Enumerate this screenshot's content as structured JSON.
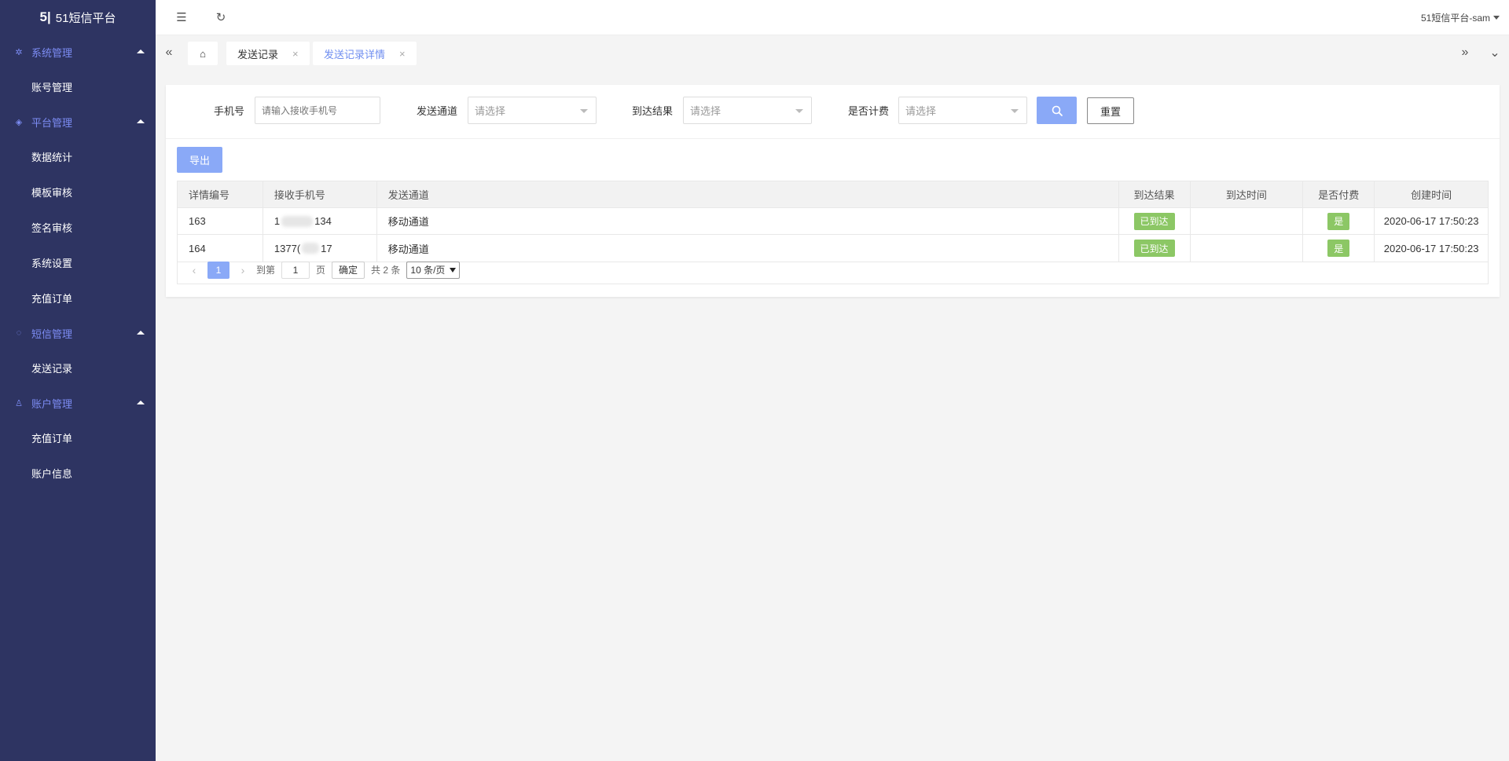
{
  "app": {
    "logo_mark": "5|",
    "title": "51短信平台"
  },
  "sidebar": {
    "groups": [
      {
        "label": "系统管理",
        "icon": "gear-icon",
        "items": [
          {
            "label": "账号管理"
          }
        ]
      },
      {
        "label": "平台管理",
        "icon": "layers-icon",
        "items": [
          {
            "label": "数据统计"
          },
          {
            "label": "模板审核"
          },
          {
            "label": "签名审核"
          },
          {
            "label": "系统设置"
          },
          {
            "label": "充值订单"
          }
        ]
      },
      {
        "label": "短信管理",
        "icon": "message-icon",
        "items": [
          {
            "label": "发送记录"
          }
        ]
      },
      {
        "label": "账户管理",
        "icon": "user-icon",
        "items": [
          {
            "label": "充值订单"
          },
          {
            "label": "账户信息"
          }
        ]
      }
    ]
  },
  "topbar": {
    "user": "51短信平台-sam"
  },
  "tabs": [
    {
      "label": "发送记录",
      "active": false
    },
    {
      "label": "发送记录详情",
      "active": true
    }
  ],
  "filters": {
    "phone": {
      "label": "手机号",
      "placeholder": "请输入接收手机号"
    },
    "channel": {
      "label": "发送通道",
      "placeholder": "请选择"
    },
    "result": {
      "label": "到达结果",
      "placeholder": "请选择"
    },
    "billing": {
      "label": "是否计费",
      "placeholder": "请选择"
    },
    "reset_label": "重置"
  },
  "export_label": "导出",
  "table": {
    "headers": [
      "详情编号",
      "接收手机号",
      "发送通道",
      "到达结果",
      "到达时间",
      "是否付费",
      "创建时间"
    ],
    "rows": [
      {
        "id": "163",
        "phone_start": "1",
        "phone_end": "134",
        "channel": "移动通道",
        "result": "已到达",
        "arrive_time": "",
        "paid": "是",
        "created": "2020-06-17 17:50:23"
      },
      {
        "id": "164",
        "phone_start": "1377(",
        "phone_end": "17",
        "channel": "移动通道",
        "result": "已到达",
        "arrive_time": "",
        "paid": "是",
        "created": "2020-06-17 17:50:23"
      }
    ]
  },
  "pager": {
    "current_page": "1",
    "goto_label": "到第",
    "page_input": "1",
    "page_unit": "页",
    "confirm_label": "确定",
    "total_label": "共 2 条",
    "page_size": "10 条/页"
  },
  "colors": {
    "sidebar_bg": "#2e3462",
    "accent": "#8aa9f7",
    "success": "#8cc765"
  }
}
